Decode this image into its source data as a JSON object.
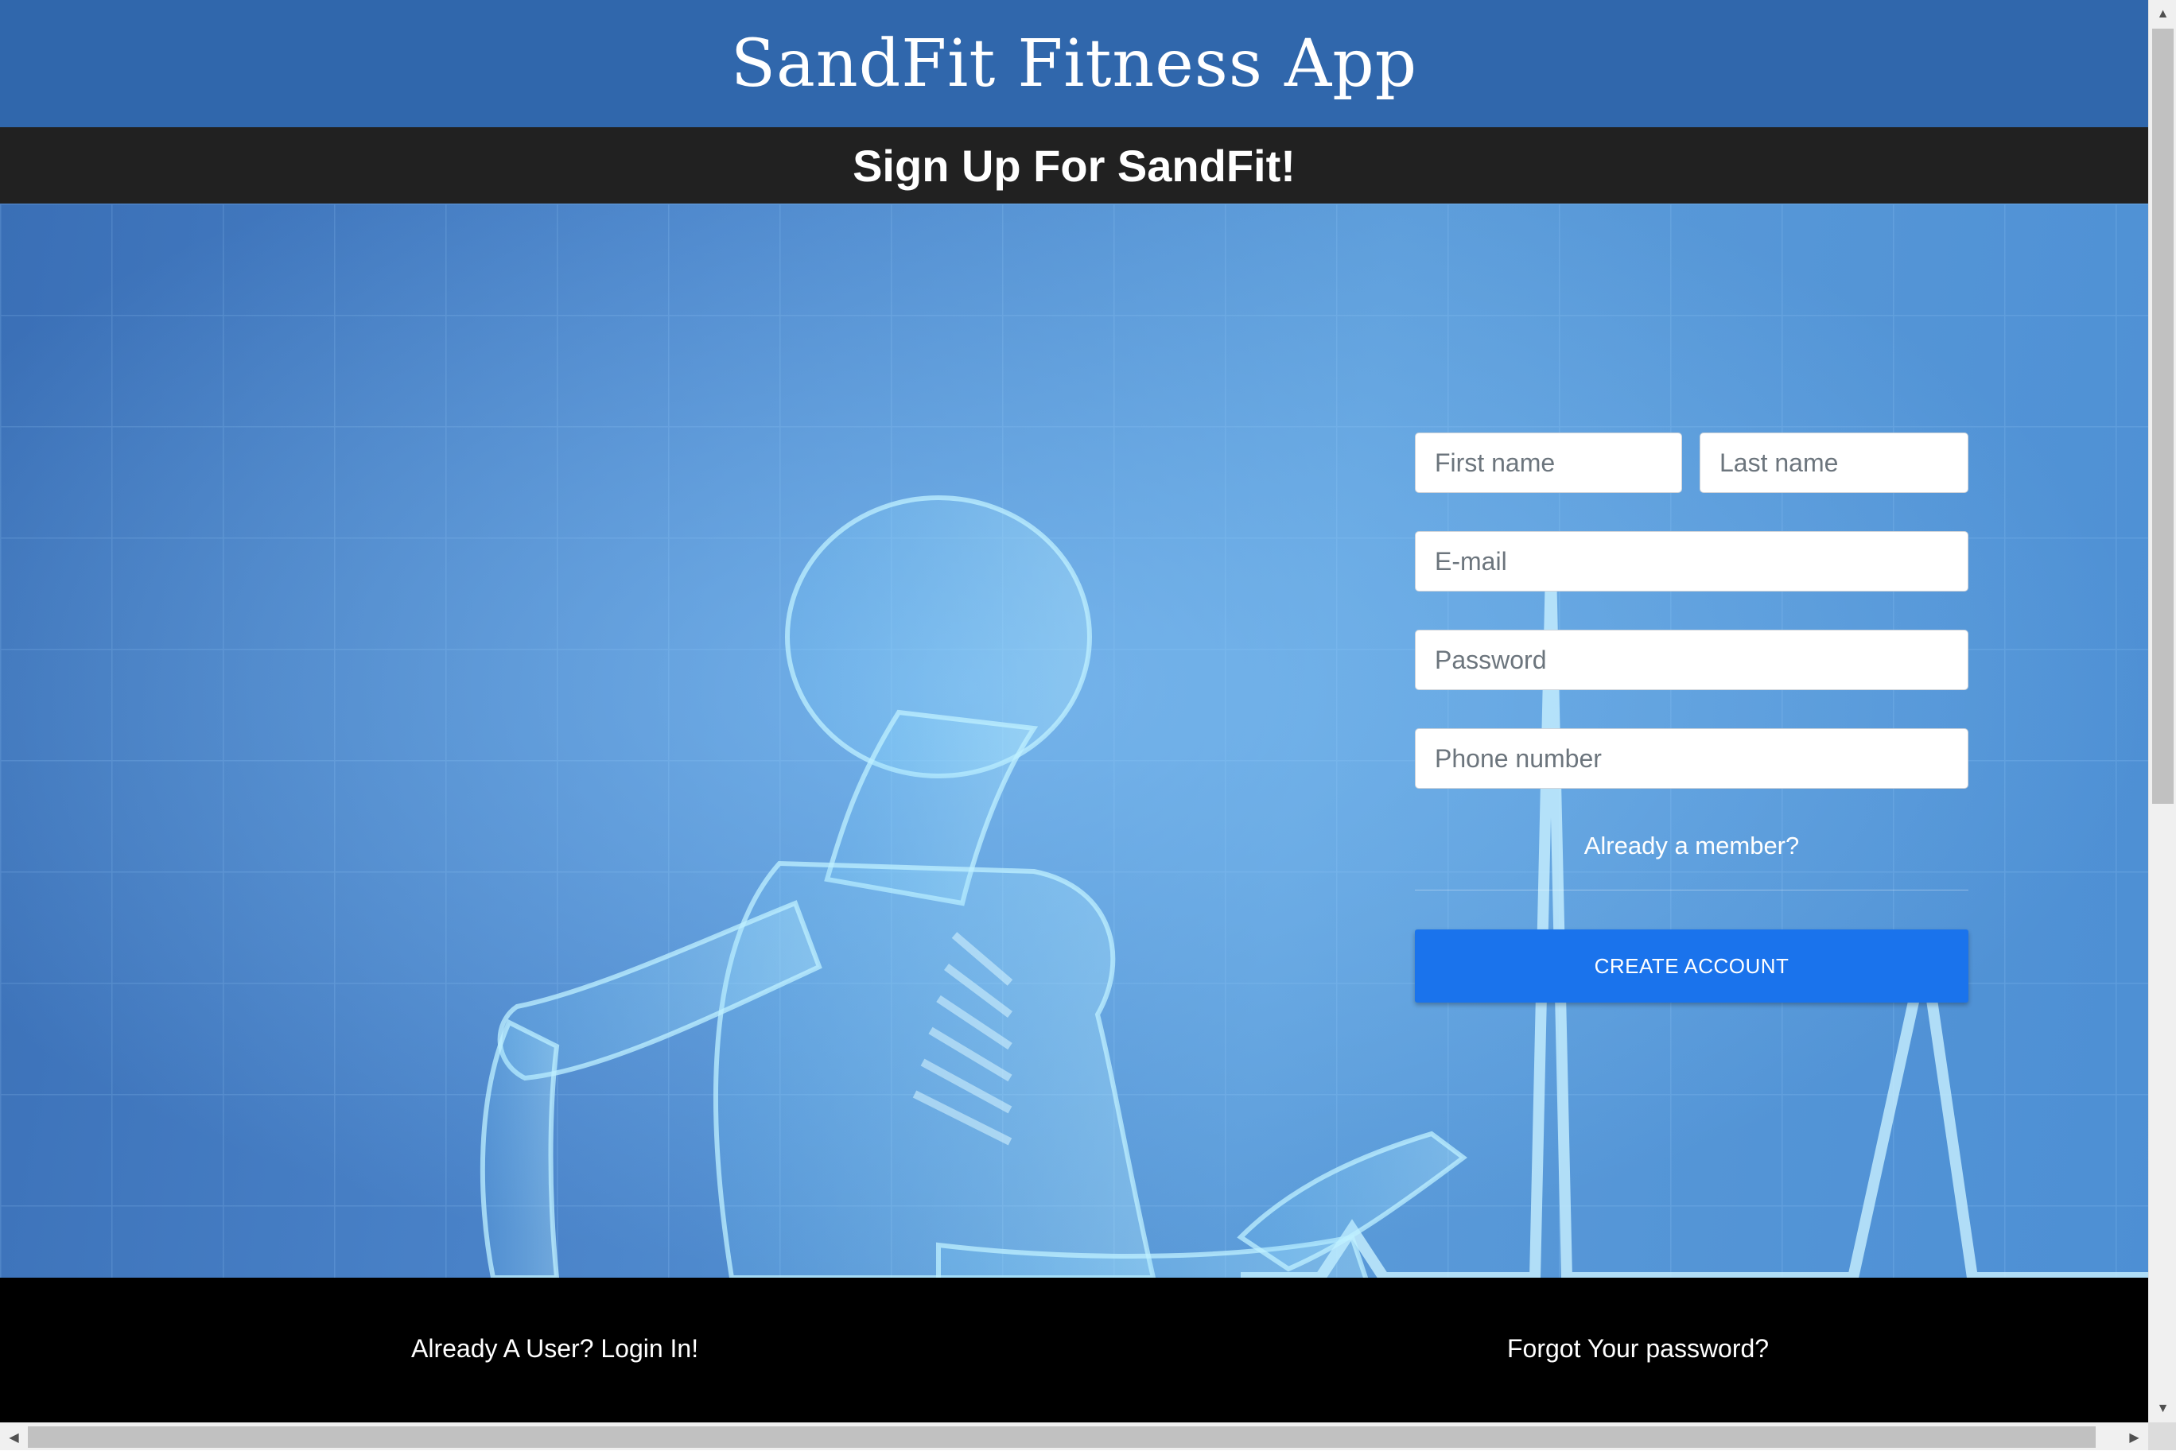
{
  "header": {
    "title": "SandFit Fitness App"
  },
  "subheader": {
    "title": "Sign Up For SandFit!"
  },
  "form": {
    "first_name_placeholder": "First name",
    "last_name_placeholder": "Last name",
    "email_placeholder": "E-mail",
    "password_placeholder": "Password",
    "phone_placeholder": "Phone number",
    "already_member": "Already a member?",
    "create_account_label": "CREATE ACCOUNT"
  },
  "footer": {
    "login_link": "Already A User? Login In!",
    "forgot_link": "Forgot Your password?"
  },
  "icons": {
    "hero_image": "xray-running-skeleton-illustration",
    "scroll_up": "triangle-up-icon",
    "scroll_down": "triangle-down-icon",
    "scroll_left": "triangle-left-icon",
    "scroll_right": "triangle-right-icon"
  },
  "colors": {
    "header_bg": "#3067ac",
    "subheader_bg": "#212121",
    "button_bg": "#1a73ec",
    "footer_bg": "#000000"
  }
}
